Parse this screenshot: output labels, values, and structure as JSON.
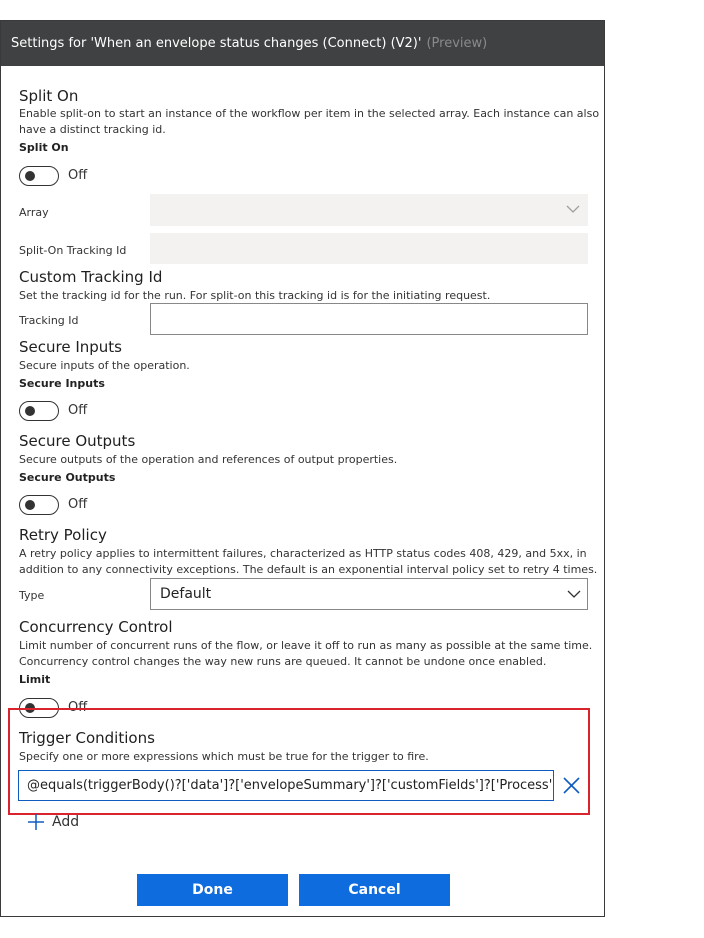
{
  "header": {
    "title": "Settings for 'When an envelope status changes (Connect) (V2)'",
    "preview_label": "(Preview)"
  },
  "split_on": {
    "title": "Split On",
    "description_line1": "Enable split-on to start an instance of the workflow per item in the selected array. Each instance can also",
    "description_line2": "have a distinct tracking id.",
    "toggle_label": "Split On",
    "toggle_state": "Off",
    "array_label": "Array",
    "tracking_id_label": "Split-On Tracking Id"
  },
  "custom_tracking": {
    "title": "Custom Tracking Id",
    "description": "Set the tracking id for the run. For split-on this tracking id is for the initiating request.",
    "field_label": "Tracking Id",
    "field_value": ""
  },
  "secure_inputs": {
    "title": "Secure Inputs",
    "description": "Secure inputs of the operation.",
    "toggle_label": "Secure Inputs",
    "toggle_state": "Off"
  },
  "secure_outputs": {
    "title": "Secure Outputs",
    "description": "Secure outputs of the operation and references of output properties.",
    "toggle_label": "Secure Outputs",
    "toggle_state": "Off"
  },
  "retry_policy": {
    "title": "Retry Policy",
    "description_line1": "A retry policy applies to intermittent failures, characterized as HTTP status codes 408, 429, and 5xx, in",
    "description_line2": "addition to any connectivity exceptions. The default is an exponential interval policy set to retry 4 times.",
    "type_label": "Type",
    "type_value": "Default"
  },
  "concurrency": {
    "title": "Concurrency Control",
    "description_line1": "Limit number of concurrent runs of the flow, or leave it off to run as many as possible at the same time.",
    "description_line2": "Concurrency control changes the way new runs are queued. It cannot be undone once enabled.",
    "toggle_label": "Limit",
    "toggle_state": "Off"
  },
  "trigger_conditions": {
    "title": "Trigger Conditions",
    "description": "Specify one or more expressions which must be true for the trigger to fire.",
    "expression": "@equals(triggerBody()?['data']?['envelopeSummary']?['customFields']?['Process'],'HF",
    "add_label": "Add",
    "highlight_color": "#d9232d"
  },
  "footer": {
    "done_label": "Done",
    "cancel_label": "Cancel",
    "button_color": "#0f6cde"
  }
}
